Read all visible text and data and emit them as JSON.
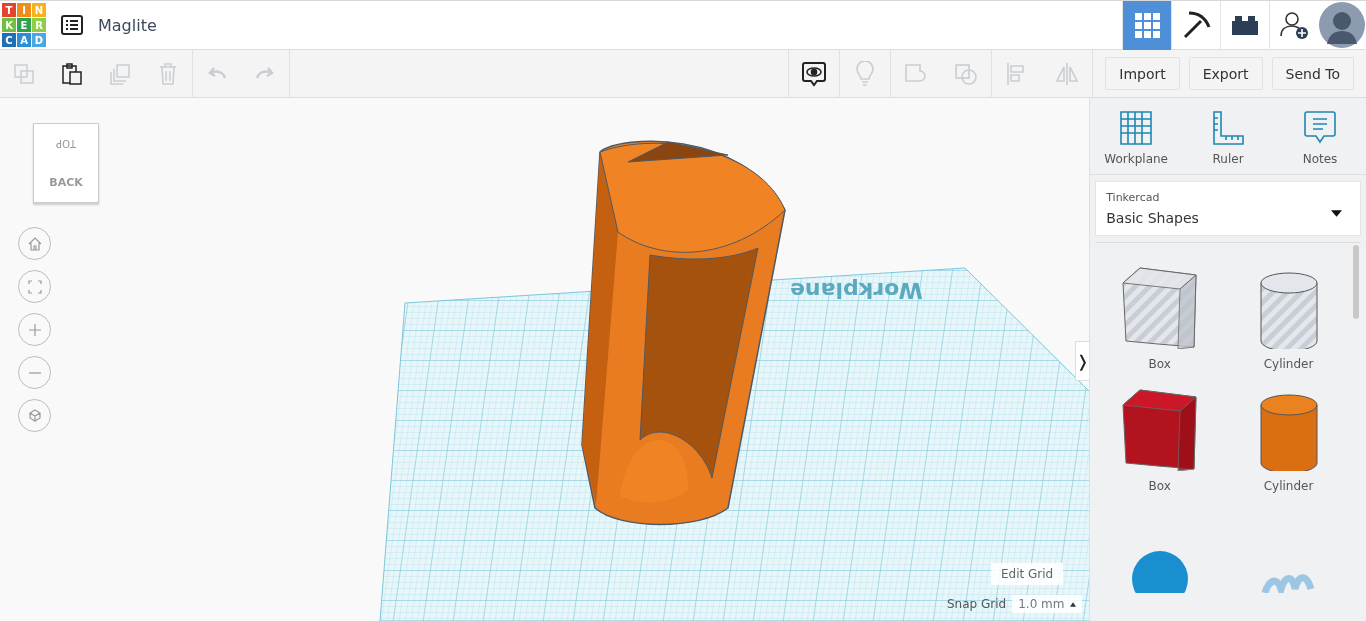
{
  "logo": [
    {
      "text": "T",
      "color": "#e2442f"
    },
    {
      "text": "I",
      "color": "#f08c1c"
    },
    {
      "text": "N",
      "color": "#f6b319"
    },
    {
      "text": "K",
      "color": "#6fbf40"
    },
    {
      "text": "E",
      "color": "#2fa34a"
    },
    {
      "text": "R",
      "color": "#8fcf48"
    },
    {
      "text": "C",
      "color": "#1f6fb5"
    },
    {
      "text": "A",
      "color": "#2c8fd6"
    },
    {
      "text": "D",
      "color": "#4aa8e0"
    }
  ],
  "design_name": "Maglite",
  "top_nav": [
    {
      "kind": "grid",
      "selected": true
    },
    {
      "kind": "pickaxe",
      "selected": false
    },
    {
      "kind": "bricks",
      "selected": false
    },
    {
      "kind": "add-user",
      "selected": false
    }
  ],
  "left_tool_groups": [
    [
      {
        "kind": "copy",
        "disabled": true
      },
      {
        "kind": "paste",
        "disabled": false
      },
      {
        "kind": "duplicate",
        "disabled": true
      },
      {
        "kind": "delete",
        "disabled": true
      }
    ],
    [
      {
        "kind": "undo",
        "disabled": true
      },
      {
        "kind": "redo",
        "disabled": true
      }
    ]
  ],
  "right_tool_groups": [
    [
      {
        "kind": "notes-view",
        "disabled": false
      }
    ],
    [
      {
        "kind": "light",
        "disabled": true
      }
    ],
    [
      {
        "kind": "group",
        "disabled": true
      },
      {
        "kind": "hole-group",
        "disabled": true
      }
    ],
    [
      {
        "kind": "align",
        "disabled": true
      },
      {
        "kind": "mirror",
        "disabled": true
      }
    ]
  ],
  "buttons": [
    "Import",
    "Export",
    "Send To"
  ],
  "view_cube": {
    "top": "TOP",
    "back": "BACK"
  },
  "nav_controls": [
    {
      "kind": "home"
    },
    {
      "kind": "fit"
    },
    {
      "kind": "zoom-in"
    },
    {
      "kind": "zoom-out"
    },
    {
      "kind": "perspective"
    }
  ],
  "workplane_label": "Workplane",
  "edit_grid": "Edit Grid",
  "snap_grid": {
    "label": "Snap Grid",
    "value": "1.0 mm"
  },
  "collapse_toggle": "❭",
  "panel_tools": [
    {
      "kind": "workplane",
      "label": "Workplane"
    },
    {
      "kind": "ruler",
      "label": "Ruler"
    },
    {
      "kind": "notes",
      "label": "Notes"
    }
  ],
  "library": {
    "category": "Tinkercad",
    "value": "Basic Shapes"
  },
  "shapes": [
    {
      "kind": "hole-box",
      "label": "Box"
    },
    {
      "kind": "hole-cylinder",
      "label": "Cylinder"
    },
    {
      "kind": "box",
      "label": "Box"
    },
    {
      "kind": "cylinder",
      "label": "Cylinder"
    },
    {
      "kind": "sphere"
    },
    {
      "kind": "scribble"
    }
  ]
}
